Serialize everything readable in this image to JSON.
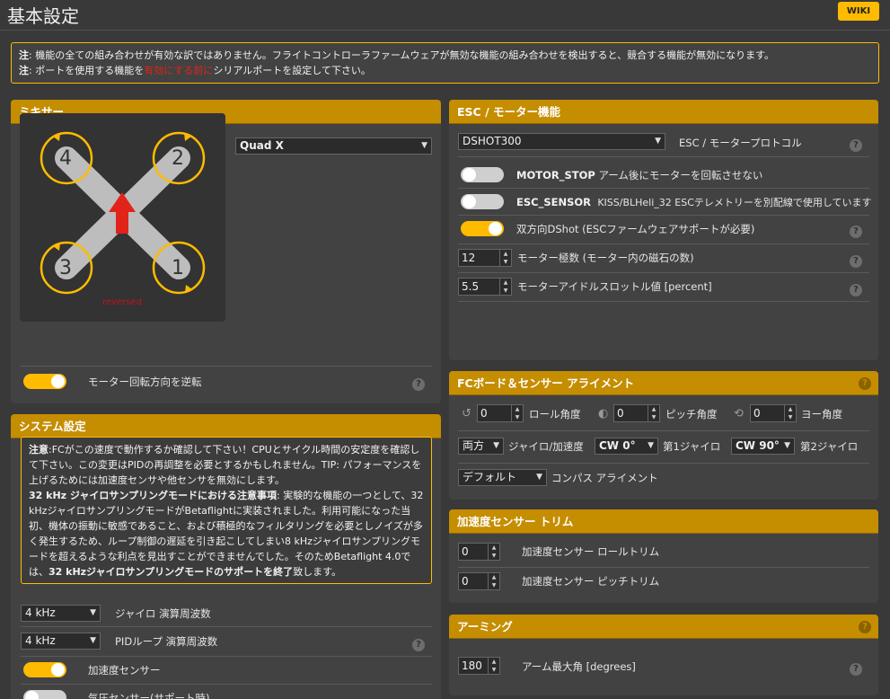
{
  "page": {
    "title": "基本設定",
    "wiki": "WIKI"
  },
  "note": {
    "line1_label": "注",
    "line1_text": ": 機能の全ての組み合わせが有効な訳ではありません。フライトコントローラファームウェアが無効な機能の組み合わせを検出すると、競合する機能が無効になります。",
    "line2_label": "注",
    "line2_text_a": ": ポートを使用する機能を",
    "line2_text_red": "有効にする前に",
    "line2_text_b": "シリアルポートを設定して下さい。"
  },
  "mixer": {
    "title": "ミキサー",
    "type_value": "Quad X",
    "reversed_label": "reversed",
    "motor_labels": [
      "4",
      "2",
      "3",
      "1"
    ],
    "reverse_label": "モーター回転方向を逆転",
    "reverse_on": true
  },
  "system": {
    "title": "システム設定",
    "note_p1_bold": "注意",
    "note_p1": ":FCがこの速度で動作するか確認して下さい！CPUとサイクル時間の安定度を確認して下さい。この変更はPIDの再調整を必要とするかもしれません。TIP: パフォーマンスを上げるためには加速度センサや他センサを無効にします。",
    "note_p2_bold": "32 kHz ジャイロサンプリングモードにおける注意事項",
    "note_p2": ": 実験的な機能の一つとして、32 kHzジャイロサンプリングモードがBetaflightに実装されました。利用可能になった当初、機体の振動に敏感であること、および積極的なフィルタリングを必要としノイズが多く発生するため、ループ制御の遅延を引き起こしてしまい8 kHzジャイロサンプリングモードを超えるような利点を見出すことができませんでした。そのためBetaflight 4.0では、",
    "note_p2_bold_end": "32 kHzジャイロサンプリングモードのサポートを終了",
    "note_p2_end": "致します。",
    "gyro_freq_value": "4 kHz",
    "gyro_freq_label": "ジャイロ 演算周波数",
    "pid_freq_value": "4 kHz",
    "pid_freq_label": "PIDループ 演算周波数",
    "accel_label": "加速度センサー",
    "accel_on": true,
    "baro_label": "気圧センサー(サポート時)",
    "baro_on": false
  },
  "esc": {
    "title": "ESC / モーター機能",
    "protocol_value": "DSHOT300",
    "protocol_label": "ESC / モータープロトコル",
    "motor_stop_name": "MOTOR_STOP",
    "motor_stop_desc": "アーム後にモーターを回転させない",
    "motor_stop_on": false,
    "esc_sensor_name": "ESC_SENSOR",
    "esc_sensor_desc": "KISS/BLHeli_32 ESCテレメトリーを別配線で使用しています",
    "esc_sensor_on": false,
    "bidir_label": "双方向DShot (ESCファームウェアサポートが必要)",
    "bidir_on": true,
    "poles_value": "12",
    "poles_label": "モーター極数 (モーター内の磁石の数)",
    "idle_value": "5.5",
    "idle_label": "モーターアイドルスロットル値 [percent]"
  },
  "alignment": {
    "title": "FCボード＆センサー アライメント",
    "roll_value": "0",
    "roll_label": "ロール角度",
    "pitch_value": "0",
    "pitch_label": "ピッチ角度",
    "yaw_value": "0",
    "yaw_label": "ヨー角度",
    "gyro_mode_value": "両方",
    "gyro_mode_label": "ジャイロ/加速度",
    "gyro1_value": "CW 0°",
    "gyro1_label": "第1ジャイロ",
    "gyro2_value": "CW 90°",
    "gyro2_label": "第2ジャイロ",
    "compass_value": "デフォルト",
    "compass_label": "コンパス アライメント"
  },
  "accel_trim": {
    "title": "加速度センサー トリム",
    "roll_value": "0",
    "roll_label": "加速度センサー ロールトリム",
    "pitch_value": "0",
    "pitch_label": "加速度センサー ピッチトリム"
  },
  "arming": {
    "title": "アーミング",
    "angle_value": "180",
    "angle_label": "アーム最大角 [degrees]"
  },
  "colors": {
    "accent": "#ffbb00",
    "header": "#c58d00",
    "background": "#393939",
    "panel": "#424242",
    "warn_red": "#e2231a"
  }
}
